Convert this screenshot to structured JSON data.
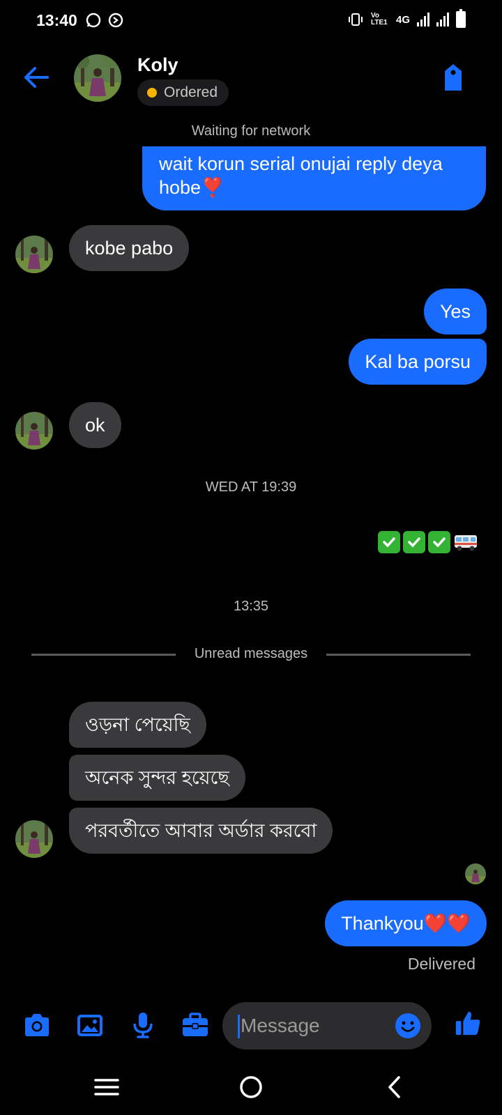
{
  "status_bar": {
    "time": "13:40",
    "network_label": "4G",
    "volte_label": "Vo LTE1"
  },
  "header": {
    "contact_name": "Koly",
    "contact_status": "Ordered",
    "status_color": "#f5b400"
  },
  "network_notice": "Waiting for network",
  "messages": [
    {
      "direction": "outgoing",
      "text": "wait korun serial onujai reply deya hobe❣️"
    },
    {
      "direction": "incoming",
      "text": "kobe pabo"
    },
    {
      "direction": "outgoing",
      "text": "Yes"
    },
    {
      "direction": "outgoing",
      "text": "Kal ba porsu"
    },
    {
      "direction": "incoming",
      "text": "ok"
    },
    {
      "direction": "timestamp",
      "text": "WED AT 19:39"
    },
    {
      "direction": "outgoing",
      "text": "✅✅✅🚐",
      "emoji_only": true
    },
    {
      "direction": "timestamp",
      "text": "13:35"
    },
    {
      "direction": "divider",
      "text": "Unread messages"
    },
    {
      "direction": "incoming",
      "text": "ওড়না পেয়েছি"
    },
    {
      "direction": "incoming",
      "text": "অনেক সুন্দর হয়েছে"
    },
    {
      "direction": "incoming",
      "text": "পরবর্তীতে আবার অর্ডার করবো"
    },
    {
      "direction": "outgoing",
      "text": "Thankyou❤️❤️"
    }
  ],
  "delivery_status": "Delivered",
  "composer": {
    "placeholder": "Message",
    "icons": [
      "camera-icon",
      "gallery-icon",
      "microphone-icon",
      "briefcase-icon",
      "emoji-icon",
      "thumbs-up-icon"
    ]
  },
  "colors": {
    "accent": "#1a6cff",
    "incoming_bubble": "#3a3a3c",
    "background": "#000000"
  }
}
